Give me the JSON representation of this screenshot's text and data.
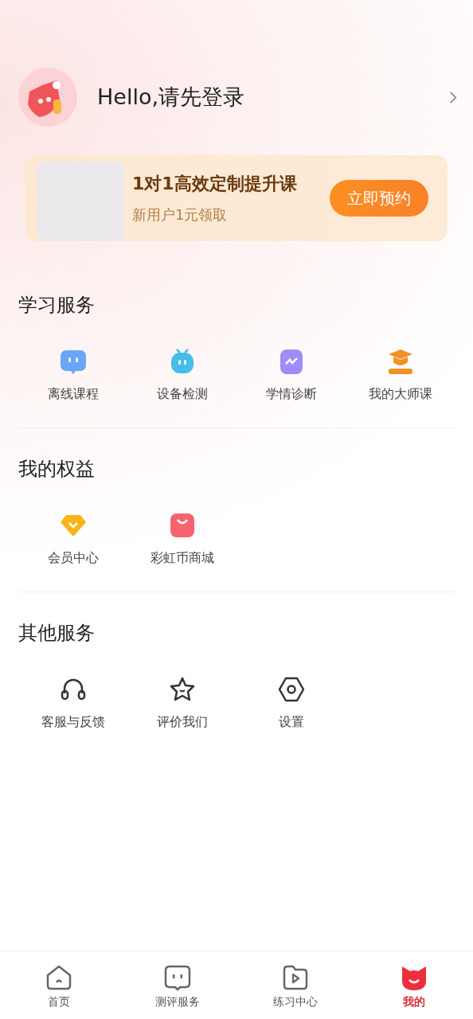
{
  "profile": {
    "greeting": "Hello,请先登录"
  },
  "banner": {
    "title": "1对1高效定制提升课",
    "subtitle": "新用户1元领取",
    "button": "立即预约"
  },
  "sections": [
    {
      "title": "学习服务",
      "items": [
        {
          "label": "离线课程"
        },
        {
          "label": "设备检测"
        },
        {
          "label": "学情诊断"
        },
        {
          "label": "我的大师课"
        }
      ]
    },
    {
      "title": "我的权益",
      "items": [
        {
          "label": "会员中心"
        },
        {
          "label": "彩虹币商城"
        }
      ]
    },
    {
      "title": "其他服务",
      "items": [
        {
          "label": "客服与反馈"
        },
        {
          "label": "评价我们"
        },
        {
          "label": "设置"
        }
      ]
    }
  ],
  "tab_bar": [
    {
      "label": "首页",
      "selected": false
    },
    {
      "label": "测评服务",
      "selected": false
    },
    {
      "label": "练习中心",
      "selected": false
    },
    {
      "label": "我的",
      "selected": true
    }
  ]
}
